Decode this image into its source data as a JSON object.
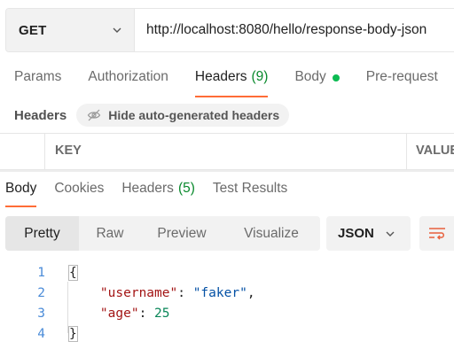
{
  "request": {
    "method": "GET",
    "url": "http://localhost:8080/hello/response-body-json"
  },
  "request_tabs": {
    "params": "Params",
    "authorization": "Authorization",
    "headers": "Headers",
    "headers_count": "(9)",
    "body": "Body",
    "pre_request": "Pre-request"
  },
  "headers_section": {
    "title": "Headers",
    "hide_button": "Hide auto-generated headers"
  },
  "headers_table": {
    "key_col": "KEY",
    "value_col": "VALUE"
  },
  "response_tabs": {
    "body": "Body",
    "cookies": "Cookies",
    "headers": "Headers",
    "headers_count": "(5)",
    "test_results": "Test Results"
  },
  "view_modes": {
    "pretty": "Pretty",
    "raw": "Raw",
    "preview": "Preview",
    "visualize": "Visualize"
  },
  "format": "JSON",
  "code": {
    "line_numbers": [
      "1",
      "2",
      "3",
      "4"
    ],
    "open_brace": "{",
    "key1": "\"username\"",
    "colon1": ": ",
    "val1": "\"faker\"",
    "comma1": ",",
    "key2": "\"age\"",
    "colon2": ": ",
    "val2": "25",
    "close_brace": "}"
  },
  "colors": {
    "accent": "#ff6c37",
    "status_green": "#0cbb52",
    "line_numbers": "#4a8bd8"
  }
}
